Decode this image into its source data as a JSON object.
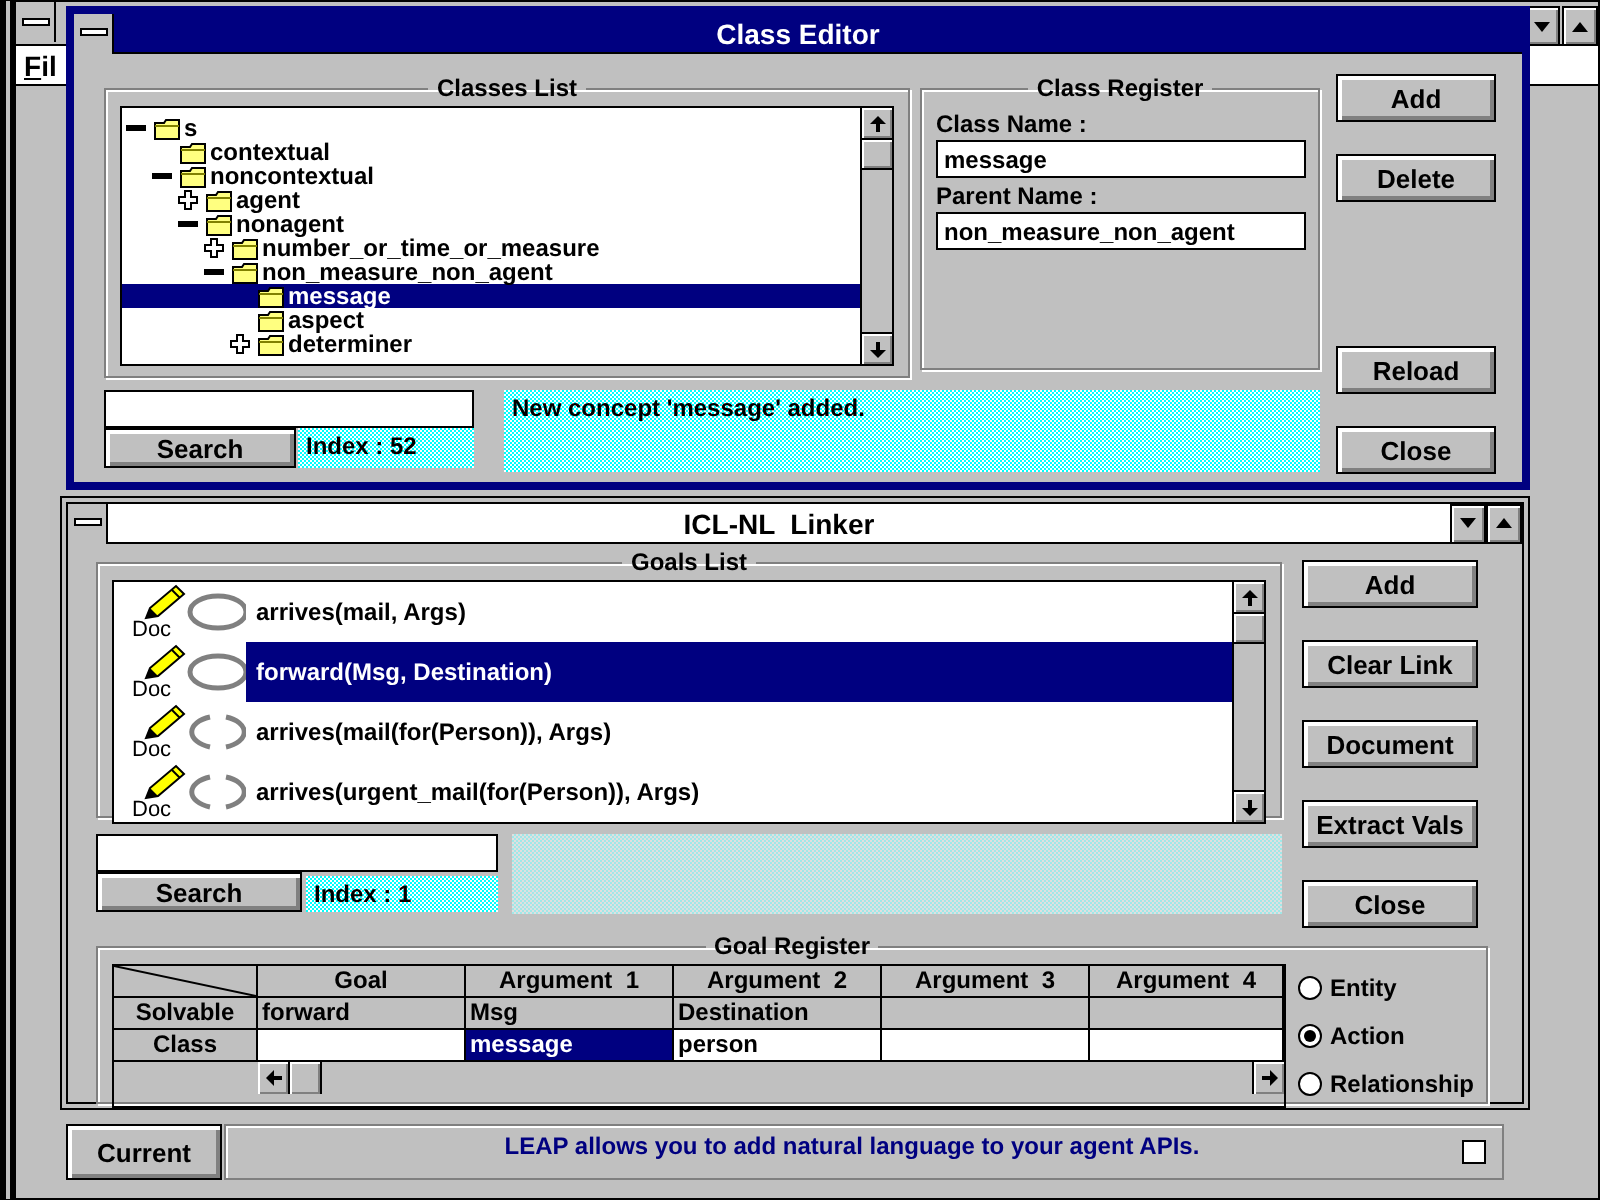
{
  "main_window": {
    "menu": [
      "Fil"
    ]
  },
  "class_editor": {
    "title": "Class Editor",
    "classes_list": {
      "title": "Classes List",
      "tree": [
        {
          "label": "s",
          "kind": "branch",
          "expanded": true,
          "selected": false,
          "children": [
            {
              "label": "contextual",
              "kind": "leaf",
              "selected": false
            },
            {
              "label": "noncontextual",
              "kind": "branch",
              "expanded": true,
              "selected": false,
              "children": [
                {
                  "label": "agent",
                  "kind": "branch",
                  "expanded": false,
                  "selected": false
                },
                {
                  "label": "nonagent",
                  "kind": "branch",
                  "expanded": true,
                  "selected": false,
                  "children": [
                    {
                      "label": "number_or_time_or_measure",
                      "kind": "branch",
                      "expanded": false,
                      "selected": false
                    },
                    {
                      "label": "non_measure_non_agent",
                      "kind": "branch",
                      "expanded": true,
                      "selected": false,
                      "children": [
                        {
                          "label": "message",
                          "kind": "leaf",
                          "selected": true
                        },
                        {
                          "label": "aspect",
                          "kind": "leaf",
                          "selected": false
                        },
                        {
                          "label": "determiner",
                          "kind": "branch",
                          "expanded": false,
                          "selected": false
                        }
                      ]
                    }
                  ]
                }
              ]
            }
          ]
        }
      ]
    },
    "search": {
      "button": "Search",
      "index": "Index : 52"
    },
    "message": "New concept 'message' added.",
    "class_register": {
      "title": "Class Register",
      "fields": [
        {
          "label": "Class Name :",
          "value": "message"
        },
        {
          "label": "Parent Name :",
          "value": "non_measure_non_agent"
        }
      ]
    },
    "buttons": [
      "Add",
      "Delete",
      "Reload",
      "Close"
    ]
  },
  "linker": {
    "title": "ICL-NL  Linker",
    "goals_list": {
      "title": "Goals List",
      "rows": [
        {
          "doc": "Doc",
          "linked": true,
          "text": "arrives(mail, Args)",
          "selected": false
        },
        {
          "doc": "Doc",
          "linked": true,
          "text": "forward(Msg, Destination)",
          "selected": true
        },
        {
          "doc": "Doc",
          "linked": false,
          "text": "arrives(mail(for(Person)), Args)",
          "selected": false
        },
        {
          "doc": "Doc",
          "linked": false,
          "text": "arrives(urgent_mail(for(Person)), Args)",
          "selected": false
        }
      ]
    },
    "search": {
      "button": "Search",
      "index": "Index : 1"
    },
    "buttons": [
      "Add",
      "Clear Link",
      "Document",
      "Extract Vals",
      "Close"
    ],
    "goal_register": {
      "title": "Goal Register",
      "columns": [
        "Goal",
        "Argument  1",
        "Argument  2",
        "Argument  3",
        "Argument  4"
      ],
      "rows": [
        {
          "label": "Solvable",
          "cells": [
            {
              "text": "forward",
              "selected": false
            },
            {
              "text": "Msg",
              "selected": false
            },
            {
              "text": "Destination",
              "selected": false
            },
            {
              "selected": false
            },
            {
              "selected": false
            }
          ]
        },
        {
          "label": "Class",
          "cells": [
            {
              "selected": false
            },
            {
              "text": "message",
              "selected": true
            },
            {
              "text": "person",
              "selected": false
            },
            {
              "selected": false
            },
            {
              "selected": false
            }
          ]
        }
      ]
    },
    "types": [
      {
        "label": "Entity",
        "selected": false
      },
      {
        "label": "Action",
        "selected": true
      },
      {
        "label": "Relationship",
        "selected": false
      }
    ]
  },
  "bottom": {
    "button": "Current",
    "status": "LEAP allows you to add natural language to your agent APIs.",
    "checkbox": {
      "checked": false
    }
  }
}
